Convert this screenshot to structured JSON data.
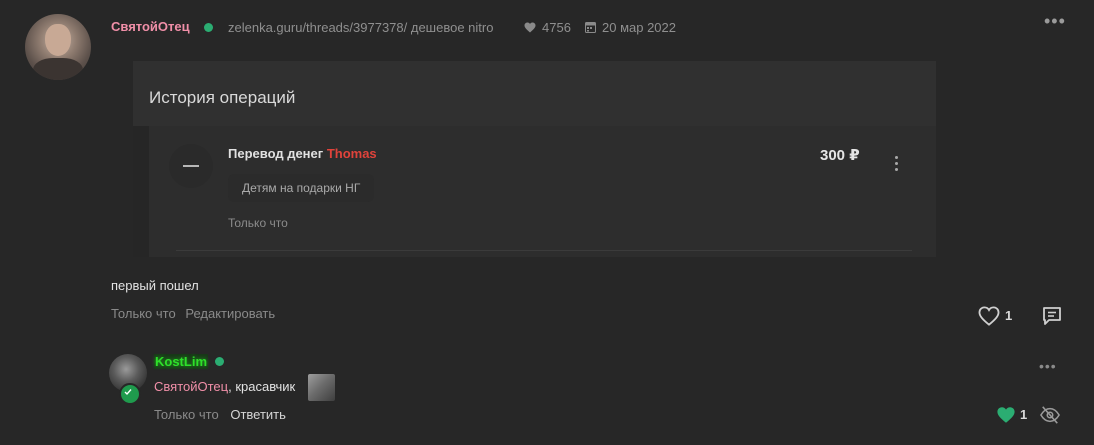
{
  "post": {
    "author": "СвятойОтец",
    "link_text": "zelenka.guru/threads/3977378/ дешевое nitro",
    "likes": "4756",
    "date": "20 мар 2022",
    "more_label": "•••",
    "text": "первый пошел",
    "time": "Только что",
    "edit_label": "Редактировать",
    "like_count": "1"
  },
  "card": {
    "title": "История операций",
    "operation": {
      "title": "Перевод денег",
      "recipient": "Thomas",
      "amount": "300 ₽",
      "comment": "Детям на подарки НГ",
      "time": "Только что"
    }
  },
  "comment": {
    "author": "KostLim",
    "mention": "СвятойОтец",
    "text": ", красавчик",
    "time": "Только что",
    "reply_label": "Ответить",
    "more_label": "•••",
    "like_count": "1"
  },
  "colors": {
    "background": "#272727",
    "author_pink": "#f08fa8",
    "online_green": "#2bad72",
    "recipient_red": "#e0433b",
    "liked_green": "#2bad72"
  },
  "icons": [
    "heart-icon",
    "calendar-icon",
    "comment-icon",
    "kebab-menu-icon",
    "eye-off-icon",
    "minus-icon"
  ]
}
